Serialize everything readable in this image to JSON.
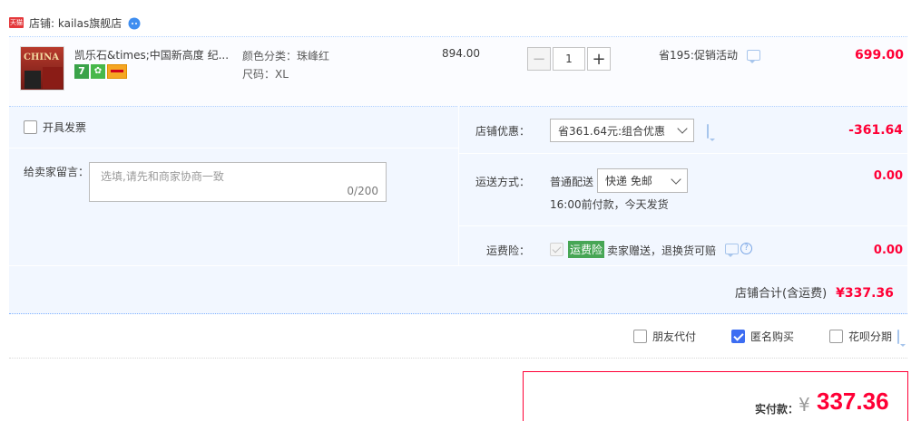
{
  "shop": {
    "badge": "天猫",
    "label": "店铺: kailas旗舰店",
    "ww_icon": "wangwang-chat-icon"
  },
  "item": {
    "image_text": "CHINA",
    "title": "凯乐石&times;中国新高度 纪...",
    "sku_color": "颜色分类：珠峰红",
    "sku_size": "尺码：XL",
    "price": "894.00",
    "quantity": "1",
    "promo": "省195:促销活动",
    "total": "699.00",
    "badges": [
      "seven-day-return-icon",
      "guarantee-icon",
      "credit-card-icon"
    ]
  },
  "invoice": {
    "label": "开具发票"
  },
  "remark": {
    "label": "给卖家留言：",
    "placeholder": "选填,请先和商家协商一致",
    "count": "0/200"
  },
  "discount": {
    "label": "店铺优惠：",
    "selected": "省361.64元:组合优惠",
    "value": "-361.64"
  },
  "shipping": {
    "label": "运送方式：",
    "type": "普通配送",
    "selected": "快递 免邮",
    "note": "16:00前付款，今天发货",
    "value": "0.00"
  },
  "insurance": {
    "label": "运费险：",
    "tag": "运费险",
    "text": "卖家赠送，退换货可赔",
    "value": "0.00"
  },
  "shop_total": {
    "label": "店铺合计(含运费)",
    "value": "¥337.36"
  },
  "options": {
    "friend_pay": "朋友代付",
    "anonymous": "匿名购买",
    "anonymous_checked": true,
    "huabei": "花呗分期"
  },
  "final": {
    "label": "实付款：",
    "currency": "¥",
    "amount": "337.36"
  },
  "colors": {
    "accent_red": "#ff0036",
    "panel_bg": "#f2f7ff",
    "checkbox_blue": "#3d6df2",
    "insurance_green": "#47a655"
  }
}
